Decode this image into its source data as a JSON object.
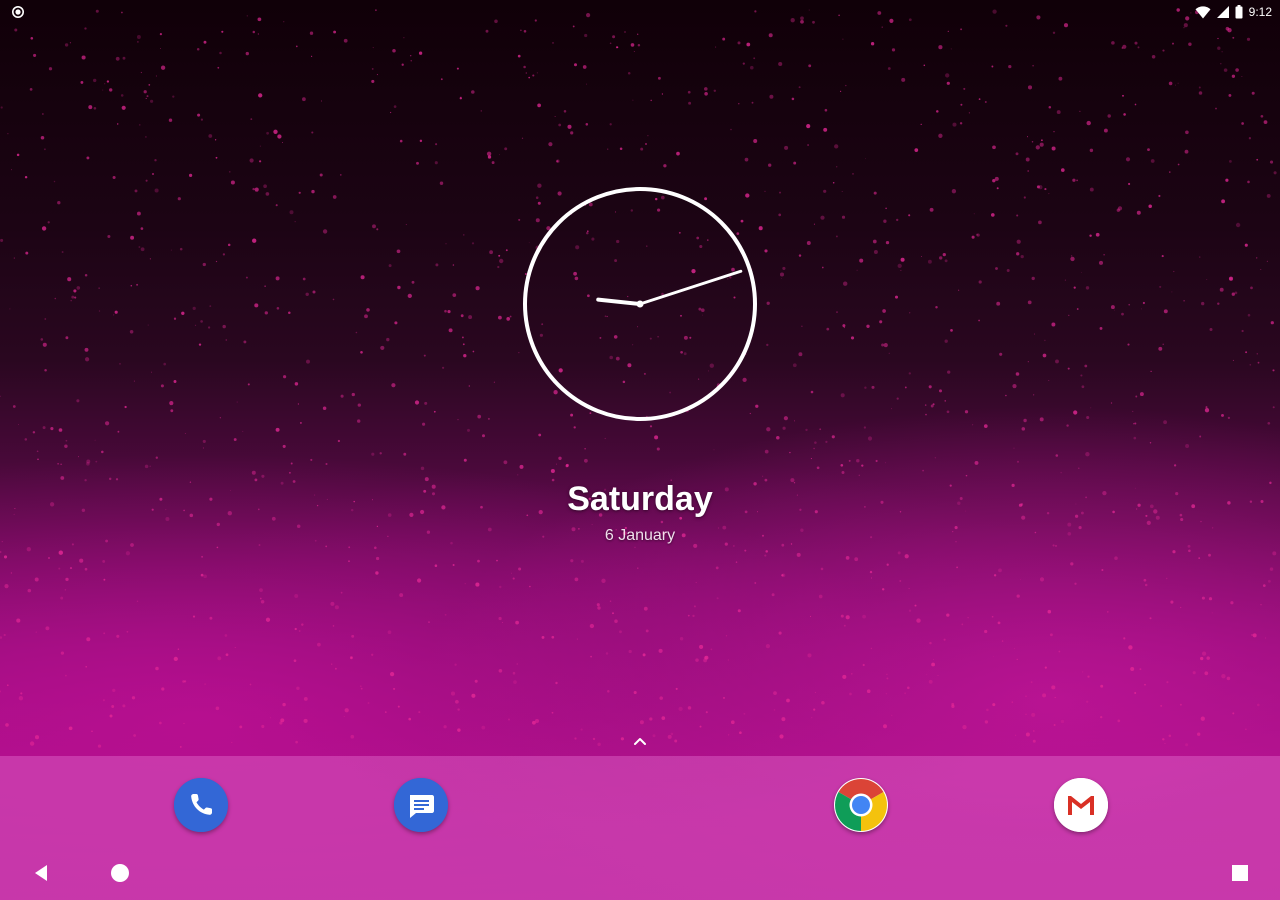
{
  "status_bar": {
    "time": "9:12",
    "left_icon": "notification-dot-icon",
    "icons": [
      "wifi-icon",
      "cell-signal-icon",
      "battery-icon"
    ]
  },
  "clock": {
    "hour": 9,
    "minute": 12
  },
  "date": {
    "day": "Saturday",
    "date": "6 January"
  },
  "drawer": {
    "icon": "chevron-up-icon"
  },
  "dock": {
    "apps": [
      {
        "name": "Phone",
        "icon": "phone-icon",
        "color": "#3367D6"
      },
      {
        "name": "Messages",
        "icon": "messages-icon",
        "color": "#3367D6"
      },
      {
        "name": "Chrome",
        "icon": "chrome-icon",
        "color": "#4285F4"
      },
      {
        "name": "Gmail",
        "icon": "gmail-icon",
        "color": "#EA4335"
      }
    ]
  },
  "nav": {
    "buttons": [
      "back-icon",
      "home-icon",
      "recents-icon"
    ]
  },
  "colors": {
    "wallpaper_accent": "#B0108E",
    "wallpaper_dark": "#100008"
  }
}
